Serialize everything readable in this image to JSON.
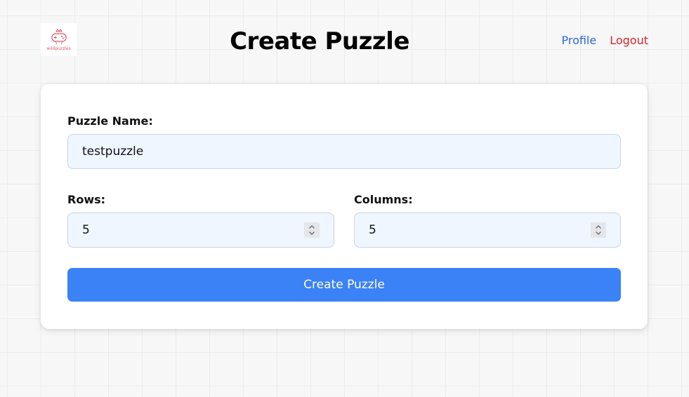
{
  "header": {
    "logo_text": "wildpuzzles",
    "title": "Create Puzzle",
    "nav": {
      "profile_label": "Profile",
      "logout_label": "Logout"
    }
  },
  "form": {
    "name_label": "Puzzle Name:",
    "name_value": "testpuzzle",
    "rows_label": "Rows:",
    "rows_value": "5",
    "columns_label": "Columns:",
    "columns_value": "5",
    "submit_label": "Create Puzzle"
  },
  "colors": {
    "accent": "#3b82f6",
    "profile_link": "#2b67e0",
    "logout_link": "#d3262f",
    "input_bg": "#eff6ff",
    "logo_pink": "#e0566b"
  },
  "icons": {
    "logo": "gamepad-crown-logo",
    "spinner": "spinner-arrows-icon"
  }
}
